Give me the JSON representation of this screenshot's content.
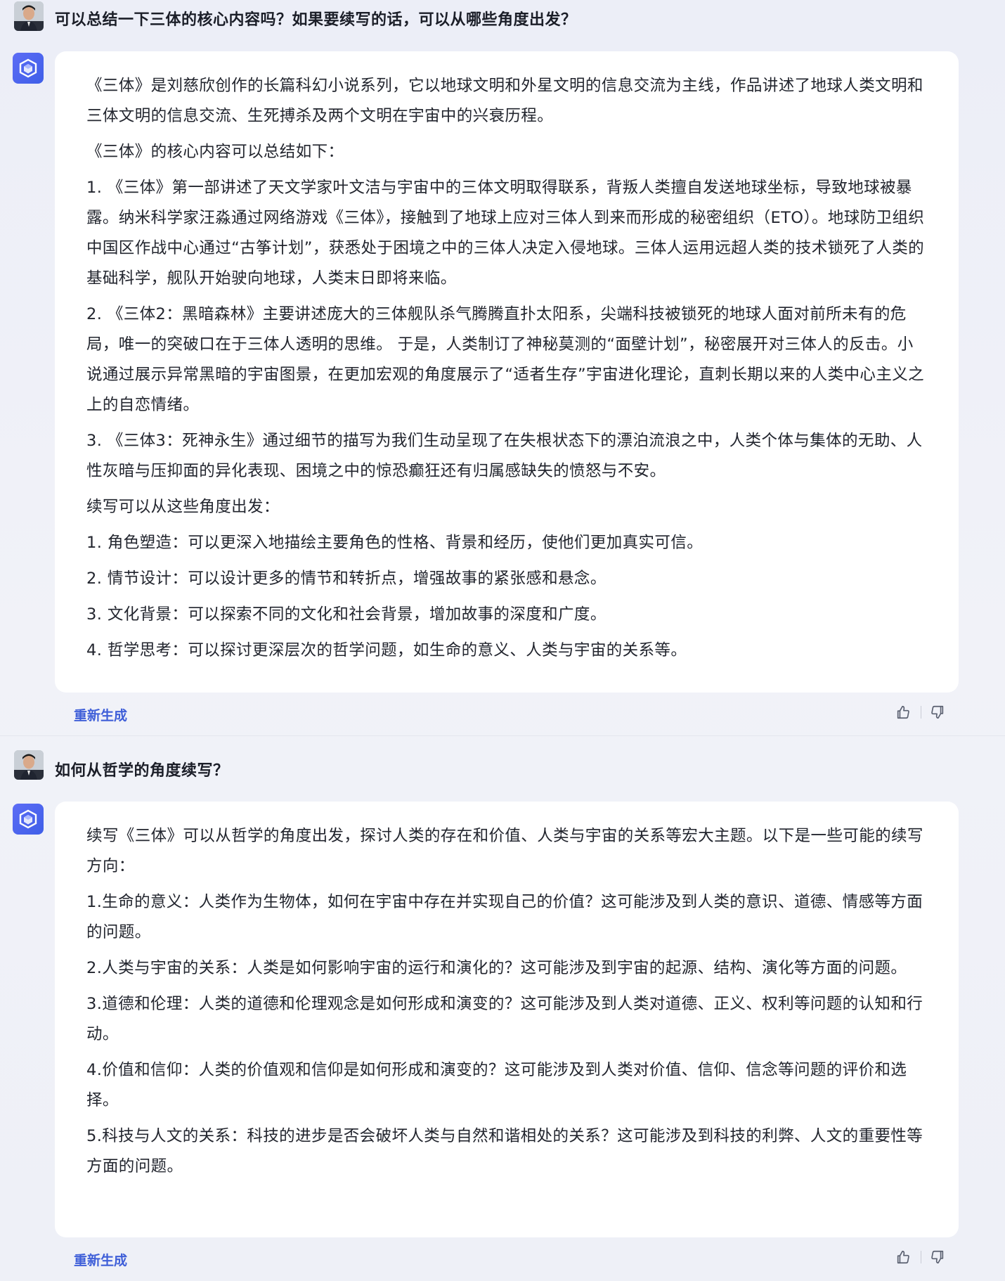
{
  "conversation": [
    {
      "question": "可以总结一下三体的核心内容吗？如果要续写的话，可以从哪些角度出发？",
      "answer": [
        "《三体》是刘慈欣创作的长篇科幻小说系列，它以地球文明和外星文明的信息交流为主线，作品讲述了地球人类文明和三体文明的信息交流、生死搏杀及两个文明在宇宙中的兴衰历程。",
        "《三体》的核心内容可以总结如下：",
        "1. 《三体》第一部讲述了天文学家叶文洁与宇宙中的三体文明取得联系，背叛人类擅自发送地球坐标，导致地球被暴露。纳米科学家汪淼通过网络游戏《三体》，接触到了地球上应对三体人到来而形成的秘密组织（ETO）。地球防卫组织中国区作战中心通过“古筝计划”，获悉处于困境之中的三体人决定入侵地球。三体人运用远超人类的技术锁死了人类的基础科学，舰队开始驶向地球，人类末日即将来临。",
        "2. 《三体2：黑暗森林》主要讲述庞大的三体舰队杀气腾腾直扑太阳系，尖端科技被锁死的地球人面对前所未有的危局，唯一的突破口在于三体人透明的思维。 于是，人类制订了神秘莫测的“面壁计划”，秘密展开对三体人的反击。小说通过展示异常黑暗的宇宙图景，在更加宏观的角度展示了“适者生存”宇宙进化理论，直刺长期以来的人类中心主义之上的自恋情绪。",
        "3. 《三体3：死神永生》通过细节的描写为我们生动呈现了在失根状态下的漂泊流浪之中，人类个体与集体的无助、人性灰暗与压抑面的异化表现、困境之中的惊恐癫狂还有归属感缺失的愤怒与不安。",
        "续写可以从这些角度出发：",
        "1. 角色塑造：可以更深入地描绘主要角色的性格、背景和经历，使他们更加真实可信。",
        "2. 情节设计：可以设计更多的情节和转折点，增强故事的紧张感和悬念。",
        "3. 文化背景：可以探索不同的文化和社会背景，增加故事的深度和广度。",
        "4. 哲学思考：可以探讨更深层次的哲学问题，如生命的意义、人类与宇宙的关系等。"
      ],
      "regenerate_label": "重新生成"
    },
    {
      "question": "如何从哲学的角度续写？",
      "answer": [
        "续写《三体》可以从哲学的角度出发，探讨人类的存在和价值、人类与宇宙的关系等宏大主题。以下是一些可能的续写方向：",
        "1.生命的意义：人类作为生物体，如何在宇宙中存在并实现自己的价值？这可能涉及到人类的意识、道德、情感等方面的问题。",
        "2.人类与宇宙的关系：人类是如何影响宇宙的运行和演化的？这可能涉及到宇宙的起源、结构、演化等方面的问题。",
        "3.道德和伦理：人类的道德和伦理观念是如何形成和演变的？这可能涉及到人类对道德、正义、权利等问题的认知和行动。",
        "4.价值和信仰：人类的价值观和信仰是如何形成和演变的？这可能涉及到人类对价值、信仰、信念等问题的评价和选择。",
        "5.科技与人文的关系：科技的进步是否会破坏人类与自然和谐相处的关系？这可能涉及到科技的利弊、人文的重要性等方面的问题。"
      ],
      "regenerate_label": "重新生成"
    }
  ],
  "icons": {
    "user_avatar": "user-avatar",
    "bot_avatar": "bot-logo-icon",
    "like": "thumbs-up-icon",
    "dislike": "thumbs-down-icon"
  },
  "colors": {
    "accent": "#3f5fd8",
    "bot_avatar": "#4f64ee",
    "card_bg": "#ffffff",
    "page_bg": "#eef0f7"
  }
}
